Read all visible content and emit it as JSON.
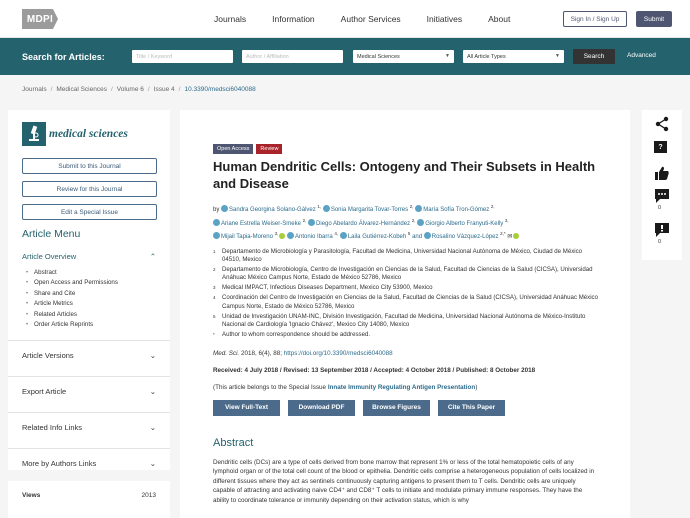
{
  "header": {
    "logo_text": "MDPI",
    "nav": [
      "Journals",
      "Information",
      "Author Services",
      "Initiatives",
      "About"
    ],
    "signin_label": "Sign In / Sign Up",
    "submit_label": "Submit"
  },
  "search": {
    "label": "Search for Articles:",
    "title_placeholder": "Title / Keyword",
    "author_placeholder": "Author / Affiliation",
    "journal_value": "Medical Sciences",
    "type_value": "All Article Types",
    "search_button": "Search",
    "advanced": "Advanced"
  },
  "breadcrumb": [
    "Journals",
    "Medical Sciences",
    "Volume 6",
    "Issue 4",
    "10.3390/medsci6040088"
  ],
  "sidebar": {
    "journal_name": "medical sciences",
    "buttons": [
      "Submit to this Journal",
      "Review for this Journal",
      "Edit a Special Issue"
    ],
    "menu_title": "Article Menu",
    "overview_label": "Article Overview",
    "overview_items": [
      "Abstract",
      "Open Access and Permissions",
      "Share and Cite",
      "Article Metrics",
      "Related Articles",
      "Order Article Reprints"
    ],
    "sections": [
      "Article Versions",
      "Export Article",
      "Related Info Links",
      "More by Authors Links"
    ],
    "views_label": "Views",
    "views_count": "2013"
  },
  "article": {
    "badge_open": "Open Access",
    "badge_review": "Review",
    "title": "Human Dendritic Cells: Ontogeny and Their Subsets in Health and Disease",
    "by": "by",
    "authors": [
      {
        "name": "Sandra Georgina Solano-Gálvez",
        "sup": "1,"
      },
      {
        "name": "Sonia Margarita Tovar-Torres",
        "sup": "2,"
      },
      {
        "name": "María Sofía Tron-Gómez",
        "sup": "2,"
      },
      {
        "name": "Ariane Estrella Weiser-Smeke",
        "sup": "2,"
      },
      {
        "name": "Diego Abelardo Álvarez-Hernández",
        "sup": "2,"
      },
      {
        "name": "Giorgio Alberto Franyuti-Kelly",
        "sup": "3,"
      },
      {
        "name": "Mijail Tapia-Moreno",
        "sup": "3,"
      },
      {
        "name": "Antonio Ibarra",
        "sup": "4,"
      },
      {
        "name": "Laila Gutiérrez-Kobeh",
        "sup": "5"
      },
      {
        "name": "Rosalino Vázquez-López",
        "sup": "2,*"
      }
    ],
    "affiliations": [
      {
        "n": "1",
        "text": "Departamento de Microbiología y Parasitología, Facultad de Medicina, Universidad Nacional Autónoma de México, Ciudad de México 04510, Mexico"
      },
      {
        "n": "2",
        "text": "Departamento de Microbiología, Centro de Investigación en Ciencias de la Salud, Facultad de Ciencias de la Salud (CICSA), Universidad Anáhuac México Campus Norte, Estado de México 52786, Mexico"
      },
      {
        "n": "3",
        "text": "Medical IMPACT, Infectious Diseases Department, Mexico City 53900, Mexico"
      },
      {
        "n": "4",
        "text": "Coordinación del Centro de Investigación en Ciencias de la Salud, Facultad de Ciencias de la Salud (CICSA), Universidad Anáhuac México Campus Norte, Estado de México 52786, Mexico"
      },
      {
        "n": "5",
        "text": "Unidad de Investigación UNAM-INC, División Investigación, Facultad de Medicina, Universidad Nacional Autónoma de México-Instituto Nacional de Cardiología 'Ignacio Chávez', Mexico City 14080, Mexico"
      },
      {
        "n": "*",
        "text": "Author to whom correspondence should be addressed."
      }
    ],
    "cite_journal": "Med. Sci.",
    "cite_rest": " 2018, 6(4), 88; ",
    "cite_doi": "https://doi.org/10.3390/medsci6040088",
    "dates": "Received: 4 July 2018 / Revised: 13 September 2018 / Accepted: 4 October 2018 / Published: 8 October 2018",
    "special_prefix": "(This article belongs to the Special Issue ",
    "special_link": "Innate Immunity Regulating Antigen Presentation",
    "special_suffix": ")",
    "actions": [
      "View Full-Text",
      "Download PDF",
      "Browse Figures",
      "Cite This Paper"
    ],
    "abstract_heading": "Abstract",
    "abstract_text": "Dendritic cells (DCs) are a type of cells derived from bone marrow that represent 1% or less of the total hematopoietic cells of any lymphoid organ or of the total cell count of the blood or epithelia. Dendritic cells comprise a heterogeneous population of cells localized in different tissues where they act as sentinels continuously capturing antigens to present them to T cells. Dendritic cells are uniquely capable of attracting and activating naive CD4⁺ and CD8⁺ T cells to initiate and modulate primary immune responses. They have the ability to coordinate tolerance or immunity depending on their activation status, which is why"
  },
  "tools": {
    "comment_count": "0",
    "review_count": "0"
  }
}
